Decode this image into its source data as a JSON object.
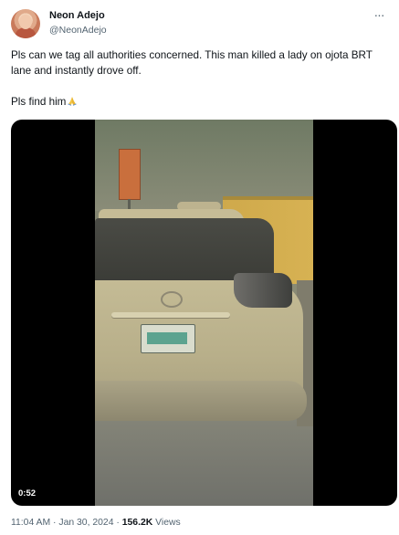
{
  "author": {
    "name": "Neon Adejo",
    "handle": "@NeonAdejo"
  },
  "more_label": "···",
  "tweet": {
    "line1": "Pls can we tag all authorities concerned. This man killed a lady on ojota BRT lane and instantly drove off.",
    "line2": "Pls find him",
    "emoji_icon": "folded-hands-icon"
  },
  "video": {
    "duration": "0:52"
  },
  "meta": {
    "time": "11:04 AM",
    "separator": "·",
    "date": "Jan 30, 2024",
    "views_count": "156.2K",
    "views_label": "Views"
  }
}
